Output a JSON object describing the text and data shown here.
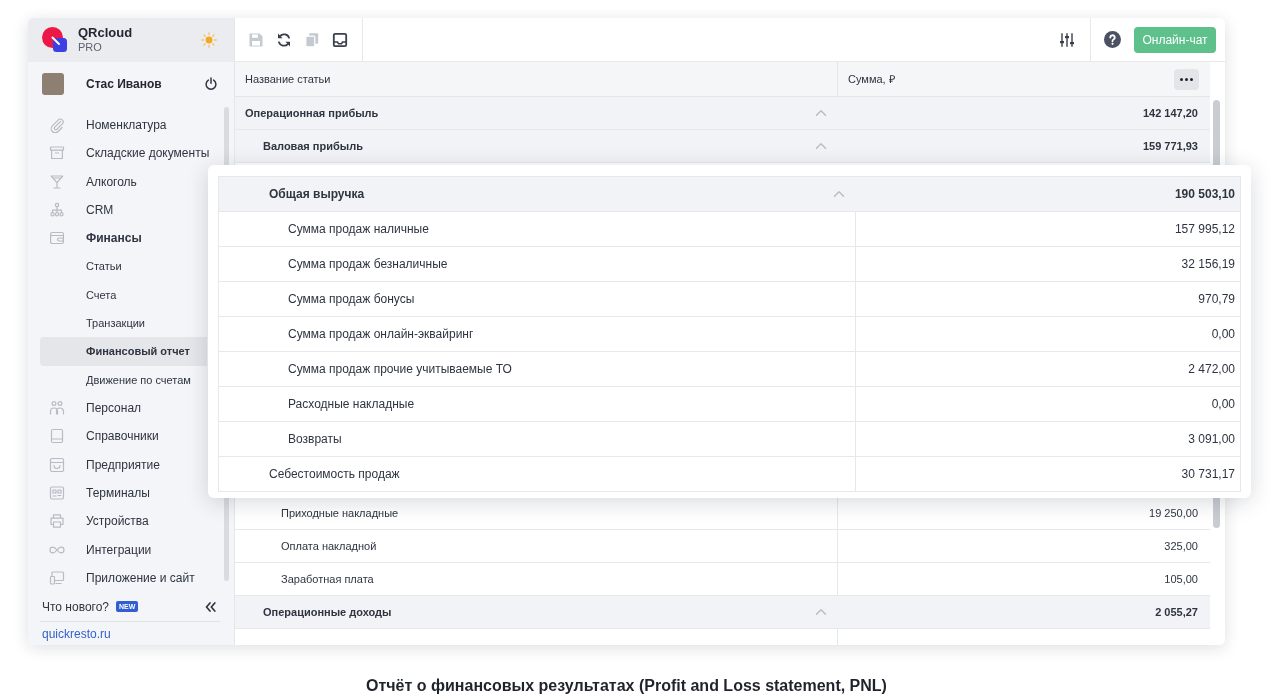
{
  "app": {
    "name": "QRcloud",
    "plan": "PRO"
  },
  "user": {
    "name": "Стас Иванов"
  },
  "sidebar": {
    "items": [
      {
        "label": "Номенклатура"
      },
      {
        "label": "Складские документы"
      },
      {
        "label": "Алкоголь"
      },
      {
        "label": "CRM"
      },
      {
        "label": "Финансы",
        "expanded": true,
        "children": [
          {
            "label": "Статьи",
            "selected": false
          },
          {
            "label": "Счета",
            "selected": false
          },
          {
            "label": "Транзакции",
            "selected": false
          },
          {
            "label": "Финансовый отчет",
            "selected": true
          },
          {
            "label": "Движение по счетам",
            "selected": false
          }
        ]
      },
      {
        "label": "Персонал"
      },
      {
        "label": "Справочники"
      },
      {
        "label": "Предприятие"
      },
      {
        "label": "Терминалы"
      },
      {
        "label": "Устройства"
      },
      {
        "label": "Интеграции"
      },
      {
        "label": "Приложение и сайт"
      }
    ],
    "whats_new": {
      "label": "Что нового?",
      "badge": "NEW"
    },
    "link": "quickresto.ru"
  },
  "toolbar": {
    "buttons": [
      {
        "disabled": true
      },
      {
        "disabled": false
      },
      {
        "disabled": true
      },
      {
        "disabled": false
      }
    ],
    "chat_label": "Онлайн-чат"
  },
  "table": {
    "columns": [
      "Название статьи",
      "Сумма, ₽"
    ],
    "rows": [
      {
        "kind": "group",
        "label": "Операционная прибыль",
        "value": "142 147,20",
        "expanded": true,
        "children": [
          {
            "kind": "group",
            "label": "Валовая прибыль",
            "value": "159 771,93",
            "expanded": true,
            "children": [
              {
                "kind": "callout",
                "rows": [
                  {
                    "kind": "group",
                    "label": "Общая выручка",
                    "value": "190 503,10",
                    "expanded": true,
                    "children": [
                      {
                        "kind": "line",
                        "label": "Сумма продаж наличные",
                        "value": "157 995,12"
                      },
                      {
                        "kind": "line",
                        "label": "Сумма продаж безналичные",
                        "value": "32 156,19"
                      },
                      {
                        "kind": "line",
                        "label": "Сумма продаж бонусы",
                        "value": "970,79"
                      },
                      {
                        "kind": "line",
                        "label": "Сумма продаж онлайн-эквайринг",
                        "value": "0,00"
                      },
                      {
                        "kind": "line",
                        "label": "Сумма продаж прочие учитываемые ТО",
                        "value": "2 472,00"
                      },
                      {
                        "kind": "line",
                        "label": "Расходные накладные",
                        "value": "0,00"
                      },
                      {
                        "kind": "line",
                        "label": "Возвраты",
                        "value": "3 091,00"
                      }
                    ]
                  },
                  {
                    "kind": "line",
                    "label": "Себестоимость продаж",
                    "value": "30 731,17"
                  }
                ]
              },
              {
                "kind": "line",
                "label": "Приходные накладные",
                "value": "19 250,00"
              },
              {
                "kind": "line",
                "label": "Оплата накладной",
                "value": "325,00"
              },
              {
                "kind": "line",
                "label": "Заработная плата",
                "value": "105,00"
              }
            ]
          },
          {
            "kind": "group",
            "label": "Операционные доходы",
            "value": "2 055,27",
            "expanded": true
          }
        ]
      }
    ]
  },
  "caption": "Отчёт о финансовых результатах (Profit and Loss statement, PNL)"
}
